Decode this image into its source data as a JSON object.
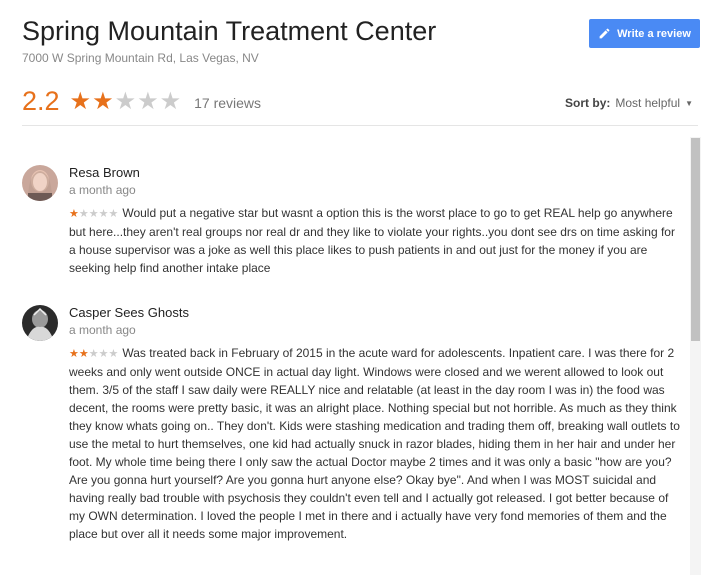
{
  "header": {
    "title": "Spring Mountain Treatment Center",
    "address": "7000 W Spring Mountain Rd, Las Vegas, NV",
    "write_review_label": "Write a review",
    "write_review_icon": "pencil-icon"
  },
  "summary": {
    "rating": "2.2",
    "stars_filled": 2,
    "stars_total": 5,
    "reviews_count": "17 reviews"
  },
  "sort": {
    "label": "Sort by:",
    "value": "Most helpful"
  },
  "colors": {
    "accent": "#e7711b",
    "button": "#4a8af4",
    "star_off": "#cccccc"
  },
  "reviews": [
    {
      "name": "Resa Brown",
      "date": "a month ago",
      "stars": 1,
      "text": "Would put a negative star but wasnt a option this is the worst place to go to get REAL help go anywhere but here...they aren't real groups nor real dr and they like to violate your rights..you dont see drs on time asking for a house supervisor was a joke as well this place likes to push patients in and out just for the money if you are seeking help find another intake place"
    },
    {
      "name": "Casper Sees Ghosts",
      "date": "a month ago",
      "stars": 2,
      "text": "Was treated back in February of 2015 in the acute ward for adolescents. Inpatient care. I was there for 2 weeks and only went outside ONCE in actual day light. Windows were closed and we werent allowed to look out them. 3/5 of the staff I saw daily were REALLY nice and relatable (at least in the day room I was in) the food was decent, the rooms were pretty basic, it was an alright place. Nothing special but not horrible. As much as they think they know whats going on.. They don't. Kids were stashing medication and trading them off, breaking wall outlets to use the metal to hurt themselves, one kid had actually snuck in razor blades, hiding them in her hair and under her foot. My whole time being there I only saw the actual Doctor maybe 2 times and it was only a basic \"how are you? Are you gonna hurt yourself? Are you gonna hurt anyone else? Okay bye\". And when I was MOST suicidal and having really bad trouble with psychosis they couldn't even tell and I actually got released. I got better because of my OWN determination. I loved the people I met in there and i actually have very fond memories of them and the place but over all it needs some major improvement."
    }
  ]
}
